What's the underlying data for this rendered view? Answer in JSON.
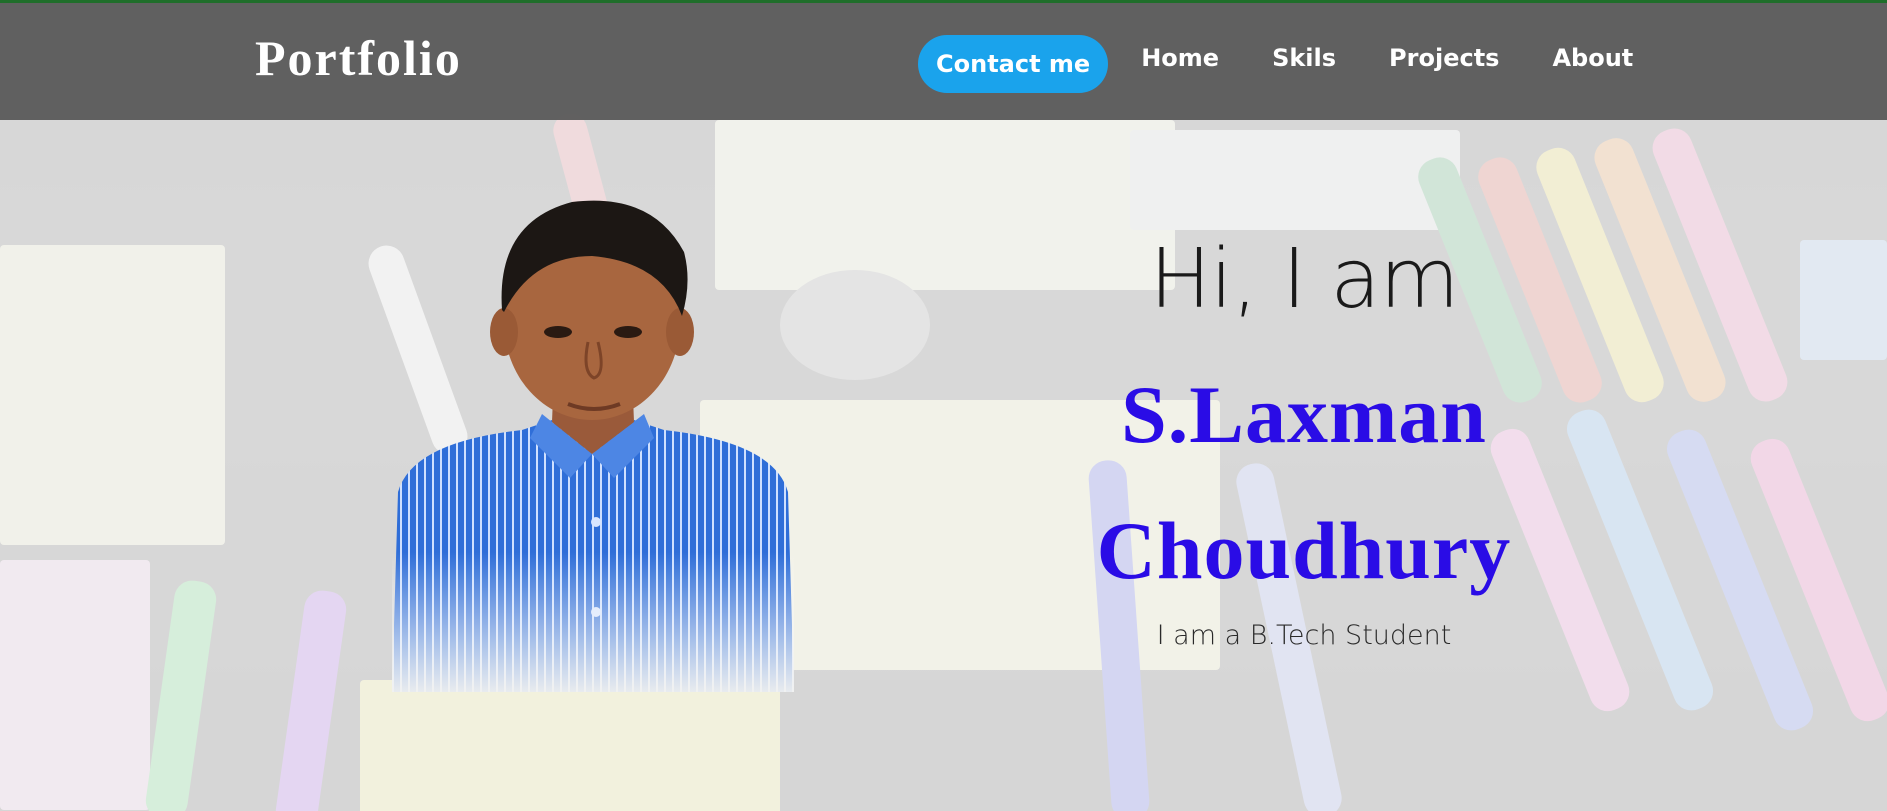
{
  "header": {
    "brand": "Portfolio",
    "nav": {
      "contact_label": "Contact me",
      "items": [
        {
          "label": "Home"
        },
        {
          "label": "Skils"
        },
        {
          "label": "Projects"
        },
        {
          "label": "About"
        }
      ]
    }
  },
  "hero": {
    "greeting": "Hi, I am",
    "name_line_1": "S.Laxman",
    "name_line_2": "Choudhury",
    "tagline": "I am a B.Tech Student"
  },
  "colors": {
    "header_bg": "#5c5c5c",
    "header_top_border": "#1f6e2a",
    "contact_button": "#1aa3ec",
    "name_text": "#2a0ce6"
  }
}
